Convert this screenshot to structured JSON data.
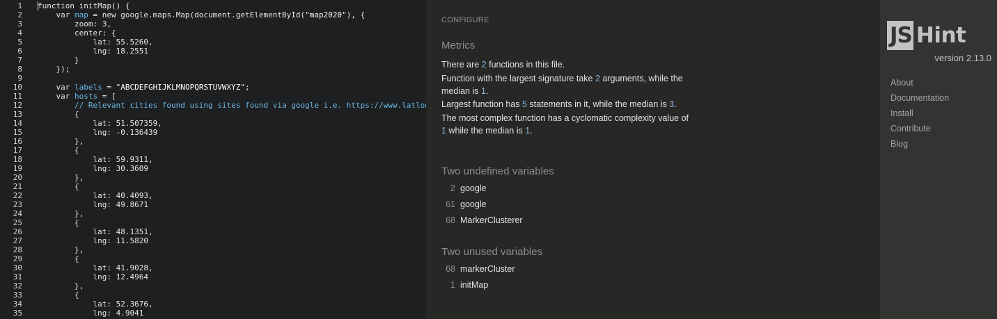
{
  "editor": {
    "lines": [
      [
        [
          "kw",
          "function initMap() {"
        ]
      ],
      [
        [
          "kw",
          "    var "
        ],
        [
          "var",
          "map"
        ],
        [
          "kw",
          " = new google.maps.Map(document.getElementById("
        ],
        [
          "str",
          "\"map2020\""
        ],
        [
          "kw",
          "), {"
        ]
      ],
      [
        [
          "kw",
          "        zoom: 3,"
        ]
      ],
      [
        [
          "kw",
          "        center: {"
        ]
      ],
      [
        [
          "kw",
          "            lat: 55.5260,"
        ]
      ],
      [
        [
          "kw",
          "            lng: 18.2551"
        ]
      ],
      [
        [
          "kw",
          "        }"
        ]
      ],
      [
        [
          "kw",
          "    });"
        ]
      ],
      [
        [
          "kw",
          ""
        ]
      ],
      [
        [
          "kw",
          "    var "
        ],
        [
          "var",
          "labels"
        ],
        [
          "kw",
          " = "
        ],
        [
          "str",
          "\"ABCDEFGHIJKLMNOPQRSTUVWXYZ\""
        ],
        [
          "kw",
          ";"
        ]
      ],
      [
        [
          "kw",
          "    var "
        ],
        [
          "var",
          "hosts"
        ],
        [
          "kw",
          " = ["
        ]
      ],
      [
        [
          "cm",
          "        // Relevant cities found using sites found via google i.e. https://www.latlong.net/"
        ]
      ],
      [
        [
          "kw",
          "        {"
        ]
      ],
      [
        [
          "kw",
          "            lat: 51.507359,"
        ]
      ],
      [
        [
          "kw",
          "            lng: -0.136439"
        ]
      ],
      [
        [
          "kw",
          "        },"
        ]
      ],
      [
        [
          "kw",
          "        {"
        ]
      ],
      [
        [
          "kw",
          "            lat: 59.9311,"
        ]
      ],
      [
        [
          "kw",
          "            lng: 30.3609"
        ]
      ],
      [
        [
          "kw",
          "        },"
        ]
      ],
      [
        [
          "kw",
          "        {"
        ]
      ],
      [
        [
          "kw",
          "            lat: 40.4093,"
        ]
      ],
      [
        [
          "kw",
          "            lng: 49.8671"
        ]
      ],
      [
        [
          "kw",
          "        },"
        ]
      ],
      [
        [
          "kw",
          "        {"
        ]
      ],
      [
        [
          "kw",
          "            lat: 48.1351,"
        ]
      ],
      [
        [
          "kw",
          "            lng: 11.5820"
        ]
      ],
      [
        [
          "kw",
          "        },"
        ]
      ],
      [
        [
          "kw",
          "        {"
        ]
      ],
      [
        [
          "kw",
          "            lat: 41.9028,"
        ]
      ],
      [
        [
          "kw",
          "            lng: 12.4964"
        ]
      ],
      [
        [
          "kw",
          "        },"
        ]
      ],
      [
        [
          "kw",
          "        {"
        ]
      ],
      [
        [
          "kw",
          "            lat: 52.3676,"
        ]
      ],
      [
        [
          "kw",
          "            lng: 4.9041"
        ]
      ],
      [
        [
          "kw",
          "        },"
        ]
      ]
    ]
  },
  "report": {
    "configure_label": "CONFIGURE",
    "metrics_title": "Metrics",
    "metrics": [
      [
        [
          "t",
          "There are "
        ],
        [
          "h",
          "2"
        ],
        [
          "t",
          " functions in this file."
        ]
      ],
      [
        [
          "t",
          "Function with the largest signature take "
        ],
        [
          "h",
          "2"
        ],
        [
          "t",
          " arguments, while the median is "
        ],
        [
          "h",
          "1"
        ],
        [
          "t",
          "."
        ]
      ],
      [
        [
          "t",
          "Largest function has "
        ],
        [
          "h",
          "5"
        ],
        [
          "t",
          " statements in it, while the median is "
        ],
        [
          "h",
          "3"
        ],
        [
          "t",
          "."
        ]
      ],
      [
        [
          "t",
          "The most complex function has a cyclomatic complexity value of "
        ],
        [
          "h",
          "1"
        ],
        [
          "t",
          " while the median is "
        ],
        [
          "h",
          "1"
        ],
        [
          "t",
          "."
        ]
      ]
    ],
    "undefined_title": "Two undefined variables",
    "undefined_vars": [
      {
        "line": "2",
        "name": "google"
      },
      {
        "line": "61",
        "name": "google"
      },
      {
        "line": "68",
        "name": "MarkerClusterer"
      }
    ],
    "unused_title": "Two unused variables",
    "unused_vars": [
      {
        "line": "68",
        "name": "markerCluster"
      },
      {
        "line": "1",
        "name": "initMap"
      }
    ]
  },
  "sidebar": {
    "logo_js": "JS",
    "logo_hint": "Hint",
    "version": "version 2.13.0",
    "nav": [
      "About",
      "Documentation",
      "Install",
      "Contribute",
      "Blog"
    ]
  }
}
